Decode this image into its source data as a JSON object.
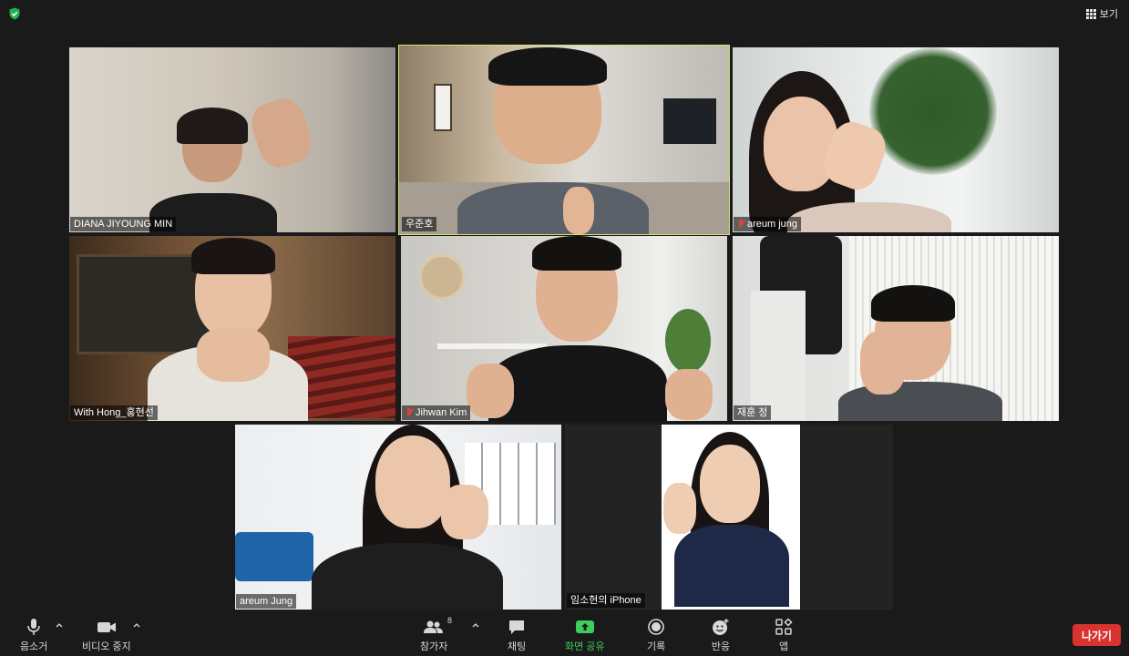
{
  "top_bar": {
    "view_label": "보기",
    "shield_color": "#23b14d"
  },
  "participants": [
    {
      "name": "DIANA JIYOUNG MIN",
      "muted": false,
      "active_speaker": false,
      "scene": "light-room"
    },
    {
      "name": "우준호",
      "muted": false,
      "active_speaker": true,
      "scene": "modern-living-room"
    },
    {
      "name": "areum jung",
      "muted": true,
      "active_speaker": false,
      "scene": "window-plants"
    },
    {
      "name": "With Hong_홍현선",
      "muted": false,
      "active_speaker": false,
      "scene": "lecture-hall"
    },
    {
      "name": "Jihwan Kim",
      "muted": true,
      "active_speaker": false,
      "scene": "home-office"
    },
    {
      "name": "재훈 정",
      "muted": false,
      "active_speaker": false,
      "scene": "curtain-room"
    },
    {
      "name": "areum Jung",
      "muted": false,
      "active_speaker": false,
      "scene": "blue-sofa-room"
    },
    {
      "name": "임소현의 iPhone",
      "muted": false,
      "active_speaker": false,
      "scene": "camera-off"
    },
    {
      "name": "",
      "muted": false,
      "active_speaker": false,
      "scene": "portrait-white-wall"
    }
  ],
  "toolbar": {
    "mute_label": "음소거",
    "video_label": "비디오 중지",
    "participants_label": "참가자",
    "participants_count": "8",
    "chat_label": "채팅",
    "share_label": "화면 공유",
    "record_label": "기록",
    "reactions_label": "반응",
    "apps_label": "앱",
    "leave_label": "나가기",
    "share_color": "#3fce5a",
    "leave_color": "#d8332f"
  }
}
